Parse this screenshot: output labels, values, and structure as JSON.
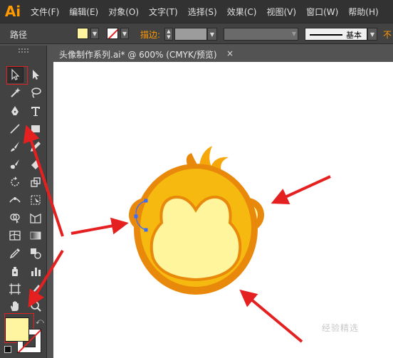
{
  "app": {
    "logo": "Ai"
  },
  "menu": {
    "items": [
      "文件(F)",
      "编辑(E)",
      "对象(O)",
      "文字(T)",
      "选择(S)",
      "效果(C)",
      "视图(V)",
      "窗口(W)",
      "帮助(H)"
    ]
  },
  "control_bar": {
    "selection_label": "路径",
    "stroke_label": "描边:",
    "brush_label": "基本",
    "opacity_label": "不",
    "fill_color": "#fff5a0",
    "stroke_color": "none"
  },
  "document": {
    "tab_title": "头像制作系列.ai* @ 600% (CMYK/预览)",
    "close_glyph": "×"
  },
  "tools": {
    "items": [
      "selection-tool",
      "direct-selection-tool",
      "magic-wand-tool",
      "lasso-tool",
      "pen-tool",
      "type-tool",
      "line-tool",
      "rectangle-tool",
      "paintbrush-tool",
      "pencil-tool",
      "blob-brush-tool",
      "eraser-tool",
      "rotate-tool",
      "scale-tool",
      "width-tool",
      "free-transform-tool",
      "shape-builder-tool",
      "perspective-grid-tool",
      "mesh-tool",
      "gradient-tool",
      "eyedropper-tool",
      "blend-tool",
      "symbol-sprayer-tool",
      "column-graph-tool",
      "artboard-tool",
      "slice-tool",
      "hand-tool",
      "zoom-tool"
    ]
  },
  "colors": {
    "fill": "#fff5a0",
    "monkey_outer": "#e8890c",
    "monkey_body": "#f6b90f",
    "monkey_face": "#fff59c",
    "arrow_red": "#e52020",
    "accent_orange": "#ff9a00"
  },
  "watermark": "经验精选"
}
